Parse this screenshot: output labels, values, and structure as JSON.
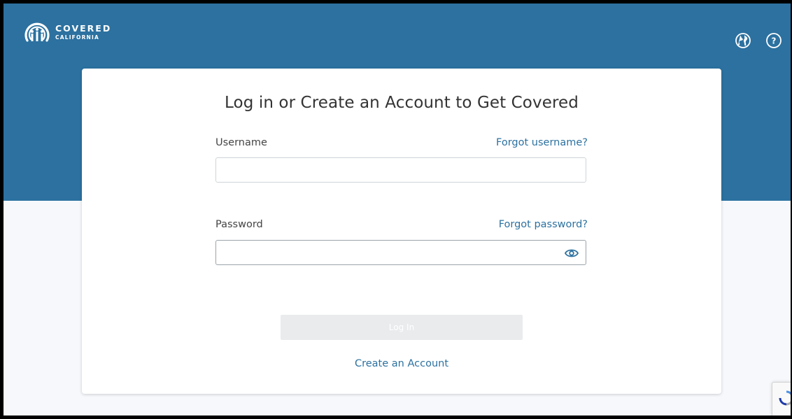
{
  "brand": {
    "line1": "COVERED",
    "line2": "CALIFORNIA"
  },
  "header": {
    "icons": [
      "globe-icon",
      "help-icon"
    ]
  },
  "form": {
    "title": "Log in or Create an Account to Get Covered",
    "username_label": "Username",
    "forgot_username": "Forgot username?",
    "username_value": "",
    "password_label": "Password",
    "forgot_password": "Forgot password?",
    "password_value": "",
    "login_button": "Log In",
    "create_account": "Create an Account"
  },
  "colors": {
    "header_bg": "#2c71a0",
    "link": "#2c71a0",
    "page_bg": "#f6f8fb",
    "button_disabled": "#e9ebed"
  }
}
